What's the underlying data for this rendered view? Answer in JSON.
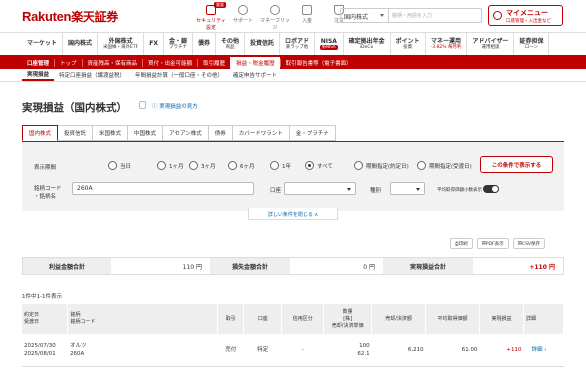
{
  "header": {
    "logo_latin": "Rakuten",
    "logo_ja": "楽天証券",
    "icons": [
      {
        "label": "セキュリティ設定",
        "badge": "重要"
      },
      {
        "label": "サポート"
      },
      {
        "label": "マネーブリッジ"
      },
      {
        "label": "入金"
      },
      {
        "label": "注文"
      }
    ],
    "search_select": "国内株式",
    "search_placeholder": "銘柄・用語を入力",
    "mymenu_title": "マイメニュー",
    "mymenu_sub": "口座管理・入出金など"
  },
  "gnav": [
    {
      "label": "マーケット"
    },
    {
      "label": "国内株式"
    },
    {
      "label": "外国株式",
      "sub": "米国株・海外ETF"
    },
    {
      "label": "FX"
    },
    {
      "label": "金・銀",
      "sub": "プラチナ"
    },
    {
      "label": "債券"
    },
    {
      "label": "その他",
      "sub": "商品"
    },
    {
      "label": "投資信託"
    },
    {
      "label": "ロボアド",
      "sub": "楽ラップ他"
    },
    {
      "label": "NISA",
      "sub": "新NISA"
    },
    {
      "label": "確定拠出年金",
      "sub": "iDeCo"
    },
    {
      "label": "ポイント",
      "sub": "投資"
    },
    {
      "label": "マネー運用",
      "sub": "-3.82% 毎月利"
    },
    {
      "label": "アドバイザー",
      "sub": "運用相談"
    },
    {
      "label": "証券担保",
      "sub": "ローン"
    }
  ],
  "subnav": {
    "title": "口座管理",
    "items": [
      "トップ",
      "資産残高・保有商品",
      "買付・出金可能額",
      "取引履歴",
      "損益・税金履歴",
      "取引報告書等（電子書面）"
    ],
    "active": 4
  },
  "tabs3": {
    "items": [
      "実現損益",
      "特定口座損益（譲渡益税）",
      "年間損益計算（一般口座・その他）",
      "確定申告サポート"
    ],
    "active": 0
  },
  "page": {
    "title": "実現損益（国内株式）",
    "help_link": "実現損益の見方"
  },
  "mtabs": {
    "items": [
      "国内株式",
      "投資信託",
      "米国株式",
      "中国株式",
      "アセアン株式",
      "債券",
      "カバードワラント",
      "金・プラチナ"
    ],
    "active": 0
  },
  "filters": {
    "period_label": "表示期間",
    "periods": [
      "当日",
      "1ヶ月",
      "3ヶ月",
      "6ヶ月",
      "1年",
      "すべて",
      "期間指定(約定日)",
      "期間指定(受渡日)"
    ],
    "period_selected": 5,
    "code_label_1": "銘柄コード",
    "code_label_2": "・銘柄名",
    "code_value": "260A",
    "account_label": "口座",
    "kind_label": "種別",
    "decimal_label": "平均取得価額小数表示",
    "submit_label": "この条件で表示する",
    "more_label": "詳しい条件を閉じる ∧"
  },
  "tools": [
    "印刷",
    "PDF表示",
    "CSV保存"
  ],
  "summary": {
    "profit_label": "利益金額合計",
    "profit_value": "110 円",
    "loss_label": "損失金額合計",
    "loss_value": "0 円",
    "realized_label": "実現損益合計",
    "realized_value": "+110 円"
  },
  "count_text": "1件中1-1件表示",
  "table": {
    "headers": [
      "約定日\n受渡日",
      "銘柄\n銘柄コード",
      "取引",
      "口座",
      "信用区分",
      "数量\n[株]\n売却/決済単価",
      "売却/決済額",
      "平均取得価額",
      "実現損益",
      "詳細"
    ],
    "rows": [
      {
        "trade_date": "2025/07/30",
        "settle_date": "2025/08/01",
        "name": "オルツ",
        "code": "260A",
        "type": "売付",
        "account": "特定",
        "margin": "-",
        "qty": "100",
        "price": "62.1",
        "amount": "6,210",
        "avg": "61.00",
        "pl": "+110",
        "detail": "詳細"
      }
    ]
  },
  "colors": {
    "accent": "#bf0000"
  }
}
